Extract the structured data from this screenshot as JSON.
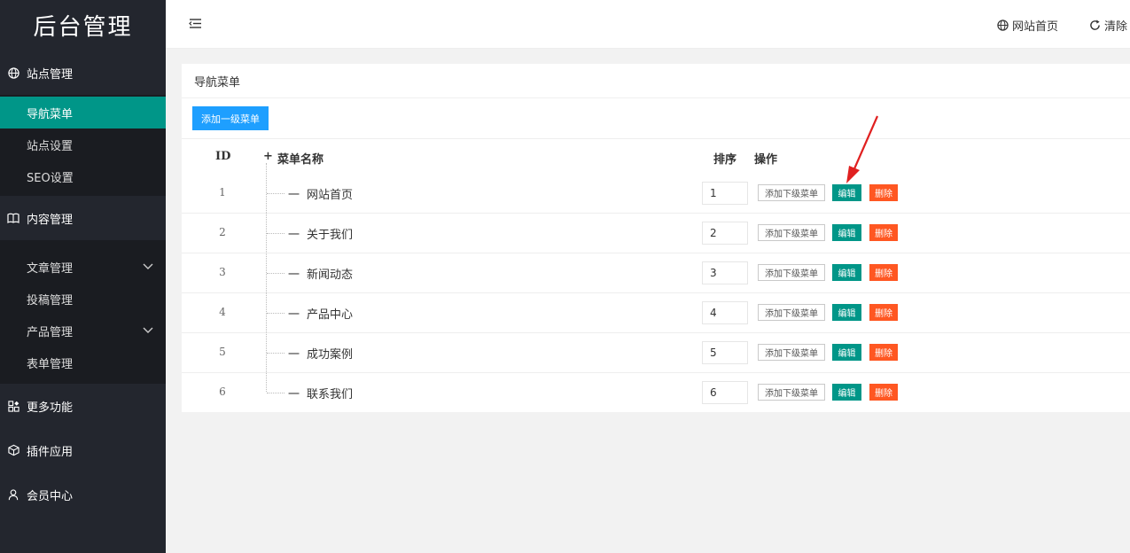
{
  "app": {
    "logo": "后台管理"
  },
  "sidebar": {
    "groups": [
      {
        "label": "站点管理",
        "icon": "globe-icon"
      },
      {
        "label": "内容管理",
        "icon": "book-icon"
      },
      {
        "label": "更多功能",
        "icon": "apps-icon"
      },
      {
        "label": "插件应用",
        "icon": "cube-icon"
      },
      {
        "label": "会员中心",
        "icon": "user-icon"
      }
    ],
    "site_items": [
      "导航菜单",
      "站点设置",
      "SEO设置"
    ],
    "content_items": [
      "文章管理",
      "投稿管理",
      "产品管理",
      "表单管理"
    ]
  },
  "header": {
    "site_home": "网站首页",
    "clear": "清除",
    "site_home_icon": "globe-icon",
    "clear_icon": "refresh-icon"
  },
  "card": {
    "title": "导航菜单",
    "add_button": "添加一级菜单",
    "columns": {
      "id": "ID",
      "expand": "+",
      "name": "菜单名称",
      "sort": "排序",
      "ops": "操作"
    },
    "rows": [
      {
        "id": "1",
        "name": "网站首页",
        "sort": "1"
      },
      {
        "id": "2",
        "name": "关于我们",
        "sort": "2"
      },
      {
        "id": "3",
        "name": "新闻动态",
        "sort": "3"
      },
      {
        "id": "4",
        "name": "产品中心",
        "sort": "4"
      },
      {
        "id": "5",
        "name": "成功案例",
        "sort": "5"
      },
      {
        "id": "6",
        "name": "联系我们",
        "sort": "6"
      }
    ],
    "row_dash": "一",
    "btn_add_sub": "添加下级菜单",
    "btn_edit": "编辑",
    "btn_delete": "删除"
  },
  "colors": {
    "sidebar": "#23262e",
    "active": "#009688",
    "primary": "#1e9fff",
    "danger": "#ff5722",
    "arrow": "#e02020"
  }
}
